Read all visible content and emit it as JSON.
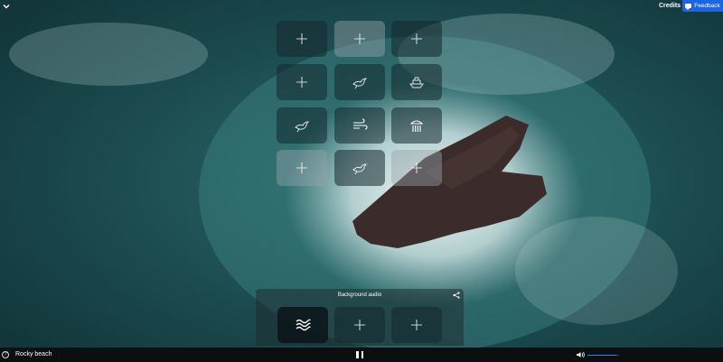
{
  "scene": {
    "name": "Rocky beach"
  },
  "header": {
    "credits_label": "Credits",
    "feedback_label": "Feedback"
  },
  "background_audio": {
    "title": "Background audio",
    "slots": [
      {
        "icon": "waves-icon",
        "state": "active"
      },
      {
        "icon": "plus-icon",
        "state": "empty"
      },
      {
        "icon": "plus-icon",
        "state": "empty"
      }
    ]
  },
  "sound_grid": {
    "rows": [
      [
        {
          "icon": "plus-icon",
          "tone": "dark"
        },
        {
          "icon": "plus-icon",
          "tone": "light"
        },
        {
          "icon": "plus-icon",
          "tone": "dark"
        }
      ],
      [
        {
          "icon": "plus-icon",
          "tone": "dark"
        },
        {
          "icon": "bird-icon",
          "tone": "dark"
        },
        {
          "icon": "boat-icon",
          "tone": "dark"
        }
      ],
      [
        {
          "icon": "bird-icon",
          "tone": "dark"
        },
        {
          "icon": "wind-icon",
          "tone": "dark"
        },
        {
          "icon": "rain-shower-icon",
          "tone": "dark"
        }
      ],
      [
        {
          "icon": "plus-icon",
          "tone": "light"
        },
        {
          "icon": "bird-icon",
          "tone": "dark"
        },
        {
          "icon": "plus-icon",
          "tone": "light"
        }
      ]
    ]
  },
  "playback": {
    "state": "playing",
    "volume": 0.9
  },
  "colors": {
    "accent": "#1d63e5",
    "bar": "#0b0f10",
    "sea": "#1a4448"
  }
}
